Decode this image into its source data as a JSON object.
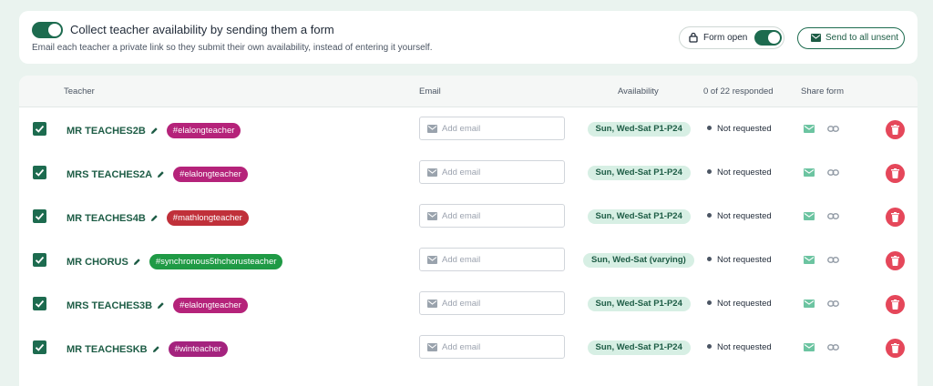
{
  "header": {
    "collect_toggle_on": true,
    "title": "Collect teacher availability by sending them a form",
    "subtitle": "Email each teacher a private link so they submit their own availability, instead of entering it yourself.",
    "form_open_label": "Form open",
    "form_open_on": true,
    "send_button_label": "Send to all unsent"
  },
  "table": {
    "columns": {
      "teacher": "Teacher",
      "email": "Email",
      "availability": "Availability",
      "responded": "0 of 22 responded",
      "share": "Share form"
    },
    "email_placeholder": "Add email",
    "rows": [
      {
        "name": "MR TEACHES2B",
        "tag": "#elalongteacher",
        "tag_color": "#b5237a",
        "availability": "Sun, Wed-Sat P1-P24",
        "status": "Not requested",
        "checked": true
      },
      {
        "name": "MRS TEACHES2A",
        "tag": "#elalongteacher",
        "tag_color": "#b5237a",
        "availability": "Sun, Wed-Sat P1-P24",
        "status": "Not requested",
        "checked": true
      },
      {
        "name": "MR TEACHES4B",
        "tag": "#mathlongteacher",
        "tag_color": "#c0303a",
        "availability": "Sun, Wed-Sat P1-P24",
        "status": "Not requested",
        "checked": true
      },
      {
        "name": "MR CHORUS",
        "tag": "#synchronous5thchorusteacher",
        "tag_color": "#1f9a45",
        "availability": "Sun, Wed-Sat (varying)",
        "status": "Not requested",
        "checked": true
      },
      {
        "name": "MRS TEACHES3B",
        "tag": "#elalongteacher",
        "tag_color": "#b5237a",
        "availability": "Sun, Wed-Sat P1-P24",
        "status": "Not requested",
        "checked": true
      },
      {
        "name": "MR TEACHESKB",
        "tag": "#winteacher",
        "tag_color": "#a4237e",
        "availability": "Sun, Wed-Sat P1-P24",
        "status": "Not requested",
        "checked": true
      }
    ]
  },
  "colors": {
    "brand_green": "#1d6b4f",
    "availability_bg": "#d7efe4",
    "delete_red": "#e5475a",
    "page_bg": "#eaf3ef"
  },
  "icons": {
    "pencil": "pencil-icon",
    "mail": "mail-icon",
    "link": "link-icon",
    "trash": "trash-icon",
    "lock": "lock-icon",
    "check": "check-icon"
  }
}
